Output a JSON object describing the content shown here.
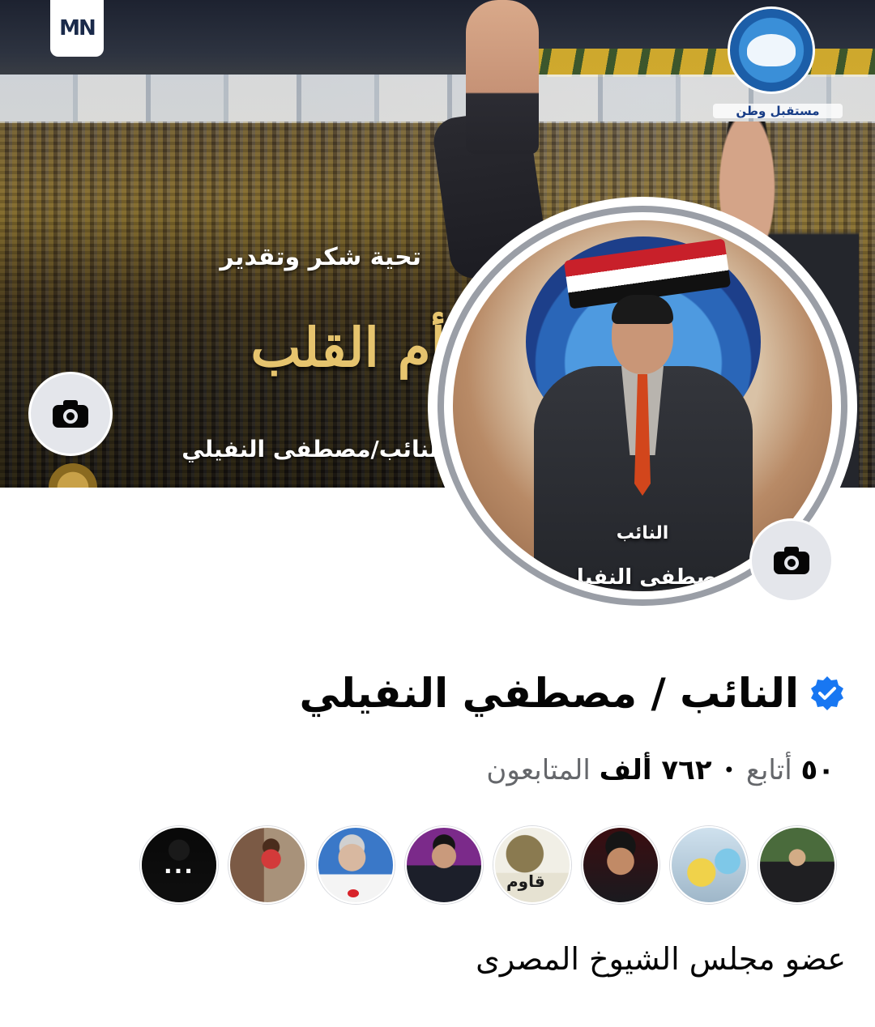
{
  "cover": {
    "logo_text": "MN",
    "party_name": "مستقبل وطن",
    "headline": "تحية شكر وتقدير",
    "calligraphy": "أم القلب",
    "cover_name": "النائب/مصطفى النفيلي"
  },
  "profile_picture": {
    "title_label": "النائب",
    "name_label": "مصطفى النفيلى"
  },
  "page": {
    "name": "النائب / مصطفي النفيلي",
    "verified": true,
    "followers_count": "٧٦٢ ألف",
    "followers_label": "المتابعون",
    "following_count": "٥٠",
    "following_label": "أتابع",
    "separator": "•",
    "bio": "عضو مجلس الشيوخ المصرى"
  },
  "friends_preview": {
    "more_label": "..."
  },
  "avatar_4_text": "قاوم",
  "colors": {
    "verified_blue": "#1877f2",
    "camera_button_bg": "#e4e6eb",
    "secondary_text": "#65676b",
    "primary_text": "#050505"
  },
  "icons": {
    "camera": "camera-icon",
    "verified": "verified-badge-icon"
  }
}
